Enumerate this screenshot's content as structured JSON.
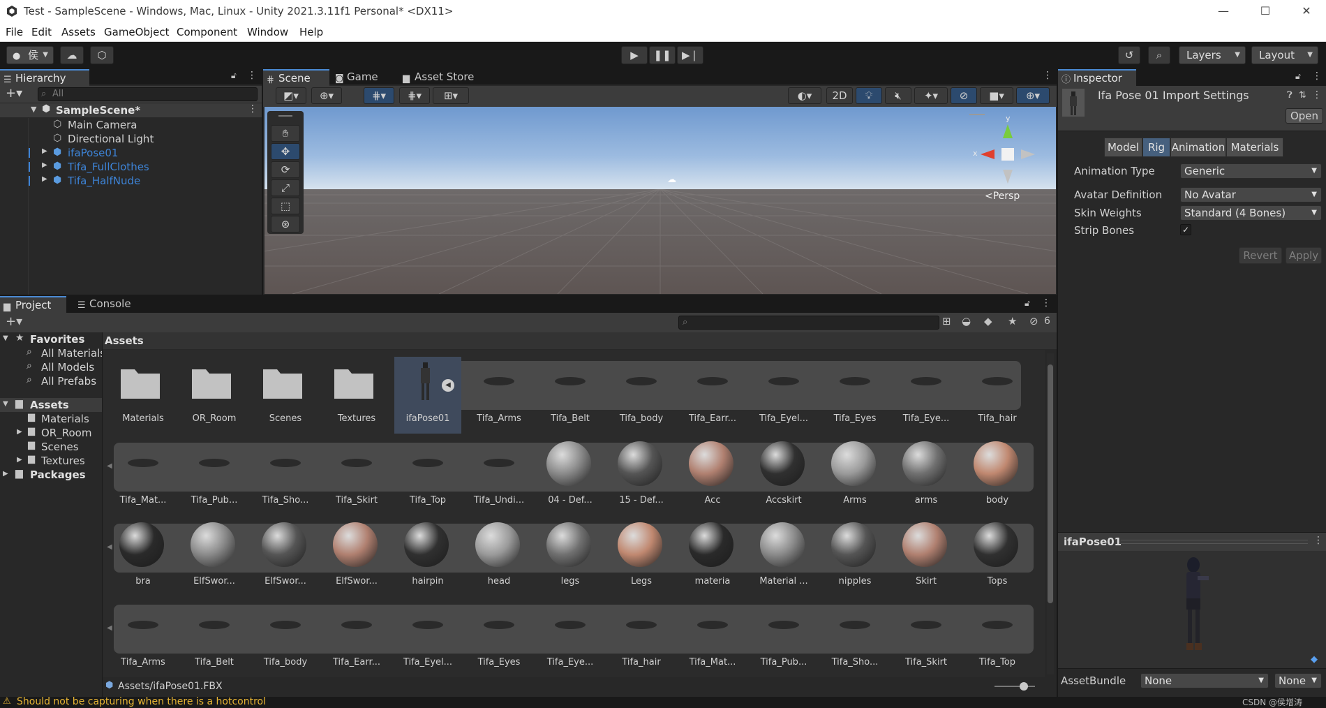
{
  "window": {
    "title": "Test - SampleScene - Windows, Mac, Linux - Unity 2021.3.11f1 Personal* <DX11>",
    "minimize": "—",
    "maximize": "☐",
    "close": "✕"
  },
  "menu": [
    "File",
    "Edit",
    "Assets",
    "GameObject",
    "Component",
    "Window",
    "Help"
  ],
  "toolbar": {
    "account_label": "侯",
    "layers_label": "Layers",
    "layout_label": "Layout"
  },
  "hierarchy": {
    "tab": "Hierarchy",
    "search_placeholder": "All",
    "scene": "SampleScene*",
    "items": [
      "Main Camera",
      "Directional Light"
    ],
    "prefabs": [
      "ifaPose01",
      "Tifa_FullClothes",
      "Tifa_HalfNude"
    ]
  },
  "scene_tabs": [
    "Scene",
    "Game",
    "Asset Store"
  ],
  "scene": {
    "btn_2d": "2D",
    "persp_label": "<Persp",
    "axis_y": "y",
    "axis_x": "x"
  },
  "project": {
    "tabs": [
      "Project",
      "Console"
    ],
    "hidden_count": "6",
    "breadcrumb": "Assets",
    "footer_path": "Assets/ifaPose01.FBX",
    "favorites": {
      "label": "Favorites",
      "items": [
        "All Materials",
        "All Models",
        "All Prefabs"
      ]
    },
    "assets_root": "Assets",
    "asset_folders": [
      "Materials",
      "OR_Room",
      "Scenes",
      "Textures"
    ],
    "packages": "Packages",
    "grid_rows": [
      [
        "Materials",
        "OR_Room",
        "Scenes",
        "Textures",
        "ifaPose01",
        "Tifa_Arms",
        "Tifa_Belt",
        "Tifa_body",
        "Tifa_Earr...",
        "Tifa_Eyel...",
        "Tifa_Eyes",
        "Tifa_Eye...",
        "Tifa_hair"
      ],
      [
        "Tifa_Mat...",
        "Tifa_Pub...",
        "Tifa_Sho...",
        "Tifa_Skirt",
        "Tifa_Top",
        "Tifa_Undi...",
        "04 - Def...",
        "15 - Def...",
        "Acc",
        "Accskirt",
        "Arms",
        "arms",
        "body"
      ],
      [
        "bra",
        "ElfSwor...",
        "ElfSwor...",
        "ElfSwor...",
        "hairpin",
        "head",
        "legs",
        "Legs",
        "materia",
        "Material ...",
        "nipples",
        "Skirt",
        "Tops"
      ],
      [
        "Tifa_Arms",
        "Tifa_Belt",
        "Tifa_body",
        "Tifa_Earr...",
        "Tifa_Eyel...",
        "Tifa_Eyes",
        "Tifa_Eye...",
        "Tifa_hair",
        "Tifa_Mat...",
        "Tifa_Pub...",
        "Tifa_Sho...",
        "Tifa_Skirt",
        "Tifa_Top"
      ]
    ]
  },
  "inspector": {
    "tab": "Inspector",
    "title": "Ifa Pose 01 Import Settings",
    "open_button": "Open",
    "subtabs": [
      "Model",
      "Rig",
      "Animation",
      "Materials"
    ],
    "selected_subtab": "Rig",
    "fields": [
      {
        "label": "Animation Type",
        "value": "Generic"
      },
      {
        "label": "Avatar Definition",
        "value": "No Avatar"
      },
      {
        "label": "Skin Weights",
        "value": "Standard (4 Bones)"
      }
    ],
    "strip_bones_label": "Strip Bones",
    "strip_bones_check": "✓",
    "revert_button": "Revert",
    "apply_button": "Apply",
    "preview_title": "ifaPose01",
    "assetbundle_label": "AssetBundle",
    "assetbundle_value": "None",
    "assetbundle_variant": "None"
  },
  "status": {
    "warning": "Should not be capturing when there is a hotcontrol",
    "watermark": "CSDN @侯增涛"
  },
  "colors": {
    "accent": "#4a8ad4",
    "prefab_text": "#3d83d6",
    "warning_text": "#e8b534"
  }
}
